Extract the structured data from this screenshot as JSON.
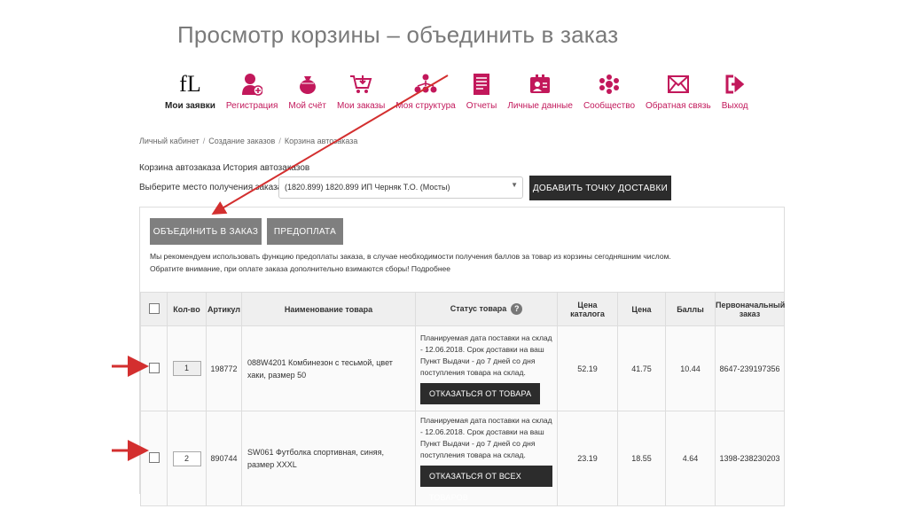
{
  "slide": {
    "title": "Просмотр корзины – объединить в заказ"
  },
  "nav": {
    "logo": "fL",
    "items": [
      {
        "label": "Мои заявки",
        "icon": "fl-logo-icon"
      },
      {
        "label": "Регистрация",
        "icon": "user-add-icon"
      },
      {
        "label": "Мой счёт",
        "icon": "money-bag-icon"
      },
      {
        "label": "Мои заказы",
        "icon": "cart-icon"
      },
      {
        "label": "Моя структура",
        "icon": "structure-icon"
      },
      {
        "label": "Отчеты",
        "icon": "report-icon"
      },
      {
        "label": "Личные данные",
        "icon": "id-card-icon"
      },
      {
        "label": "Сообщество",
        "icon": "community-icon"
      },
      {
        "label": "Обратная связь",
        "icon": "envelope-icon"
      },
      {
        "label": "Выход",
        "icon": "exit-icon"
      }
    ],
    "accent": "#c2185b"
  },
  "breadcrumb": [
    "Личный кабинет",
    "Создание заказов",
    "Корзина автозаказа"
  ],
  "cart_header": "Корзина автозаказа История автозаказов",
  "delivery": {
    "label": "Выберите место получения заказа",
    "selected": "(1820.899) 1820.899 ИП Черняк Т.О. (Мосты)",
    "add_button": "ДОБАВИТЬ ТОЧКУ ДОСТАВКИ"
  },
  "actions": {
    "merge": "ОБЪЕДИНИТЬ В ЗАКАЗ",
    "prepay": "ПРЕДОПЛАТА"
  },
  "notice": {
    "line1": "Мы рекомендуем использовать функцию предоплаты заказа, в случае необходимости получения баллов за товар из корзины сегодняшним числом.",
    "line2": "Обратите внимание, при оплате заказа дополнительно взимаются сборы! Подробнее"
  },
  "table": {
    "headers": {
      "qty": "Кол-во",
      "article": "Артикул",
      "name": "Наименование товара",
      "status": "Статус товара",
      "catalog_price_1": "Цена",
      "catalog_price_2": "каталога",
      "price": "Цена",
      "points": "Баллы",
      "original_1": "Первоначальный",
      "original_2": "заказ"
    },
    "help_glyph": "?",
    "rows": [
      {
        "qty": "1",
        "article": "198772",
        "name": "088W4201 Комбинезон с тесьмой, цвет хаки, размер 50",
        "status": "Планируемая дата поставки на склад - 12.06.2018. Срок доставки на ваш Пункт Выдачи - до 7 дней со дня поступления товара на склад.",
        "action": "ОТКАЗАТЬСЯ ОТ ТОВАРА",
        "catalog_price": "52.19",
        "price": "41.75",
        "points": "10.44",
        "original": "8647-239197356"
      },
      {
        "qty": "2",
        "article": "890744",
        "name": "SW061 Футболка спортивная, синяя, размер XXXL",
        "status": "Планируемая дата поставки на склад - 12.06.2018. Срок доставки на ваш Пункт Выдачи - до 7 дней со дня поступления товара на склад.",
        "action": "ОТКАЗАТЬСЯ ОТ ВСЕХ ТОВАРОВ",
        "catalog_price": "23.19",
        "price": "18.55",
        "points": "4.64",
        "original": "1398-238230203"
      }
    ]
  },
  "annotation_color": "#d32f2f"
}
